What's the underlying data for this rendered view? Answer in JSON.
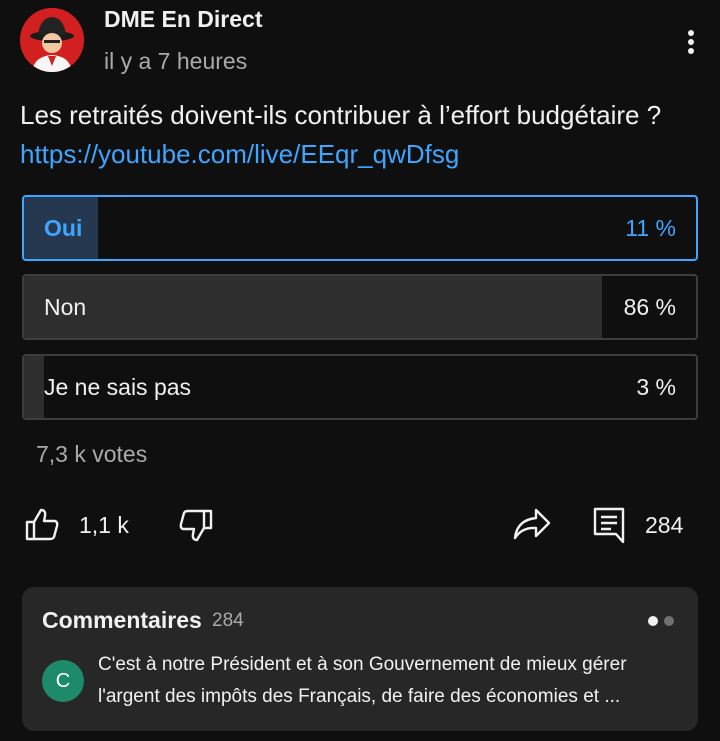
{
  "post": {
    "channel_name": "DME En Direct",
    "time_ago": "il y a 7 heures",
    "text": "Les retraités doivent-ils contribuer à l’effort budgétaire ? ",
    "link": "https://youtube.com/live/EEqr_qwDfsg"
  },
  "poll": {
    "options": [
      {
        "label": "Oui",
        "percent_label": "11 %",
        "percent": 11,
        "selected": true
      },
      {
        "label": "Non",
        "percent_label": "86 %",
        "percent": 86,
        "selected": false
      },
      {
        "label": "Je ne sais pas",
        "percent_label": "3 %",
        "percent": 3,
        "selected": false
      }
    ],
    "votes": "7,3 k votes"
  },
  "actions": {
    "like_count": "1,1 k",
    "comment_count": "284"
  },
  "comments": {
    "title": "Commentaires",
    "count": "284",
    "author_initial": "C",
    "line1": "C'est à notre Président et à son Gouvernement de mieux gérer",
    "line2": "l'argent des impôts des Français, de faire des économies et ..."
  },
  "colors": {
    "background": "#0f0f0f",
    "accent": "#3ea6ff",
    "channel_avatar": "#d21f1f",
    "comment_avatar": "#1d8a6c"
  },
  "icons": [
    "more-vert-icon",
    "like-icon",
    "dislike-icon",
    "share-icon",
    "comment-icon"
  ]
}
